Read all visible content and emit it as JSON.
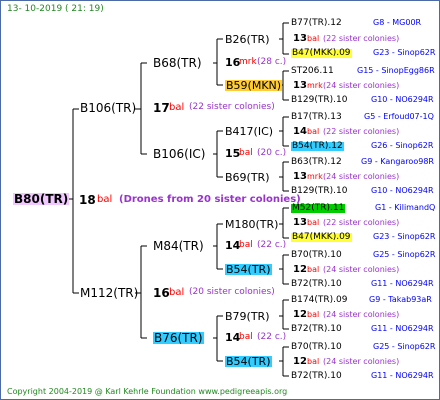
{
  "header": {
    "date_text": "13- 10-2019 ( 21: 19)"
  },
  "footer": {
    "copyright": "Copyright 2004-2019 @ Karl Kehrle Foundation   www.pedigreeapis.org"
  },
  "colors": {
    "yellow_hl": "#ffff33",
    "orange_hl": "#ffcc33",
    "cyan_hl": "#33ccff",
    "green_hl": "#00cc00",
    "pink_hl": "#f0c8ff",
    "red": "#ff0000",
    "blue": "#0000ff",
    "purple": "#9933cc"
  },
  "root": {
    "label": "B80(TR)",
    "gen": "18",
    "gen_unit": "bal",
    "note": "(Drones from 20 sister colonies)"
  },
  "gen1": [
    {
      "label": "B106(TR)",
      "gen": "17",
      "gen_unit": "bal",
      "note": "(22 sister colonies)"
    },
    {
      "label": "M112(TR)",
      "gen": "16",
      "gen_unit": "bal",
      "note": "(20 sister colonies)"
    }
  ],
  "gen2": [
    {
      "label": "B68(TR)",
      "gen": "16",
      "gen_unit": "mrk",
      "note": "(28 c.)"
    },
    {
      "label": "B106(IC)",
      "gen": "15",
      "gen_unit": "bal",
      "note": "(20 c.)"
    },
    {
      "label": "M84(TR)",
      "gen": "14",
      "gen_unit": "bal",
      "note": "(22 c.)"
    },
    {
      "label": "B76(TR)",
      "gen": "14",
      "gen_unit": "bal",
      "note": "(22 c.)"
    }
  ],
  "gen3": [
    {
      "label": "B26(TR)"
    },
    {
      "label": "B59(MKN)"
    },
    {
      "label": "B417(IC)"
    },
    {
      "label": "B69(TR)"
    },
    {
      "label": "M180(TR)"
    },
    {
      "label": "B54(TR)"
    },
    {
      "label": "B79(TR)"
    },
    {
      "label": "B54(TR)"
    }
  ],
  "gen4": [
    {
      "name": "B77(TR).12",
      "code": "G8 - MG00R"
    },
    {
      "gen": "13",
      "unit": "bal",
      "note": "(22 sister colonies)"
    },
    {
      "name": "B47(MKK).09",
      "code": "G23 - Sinop62R"
    },
    {
      "name": "ST206.11",
      "code": "G15 - SinopEgg86R"
    },
    {
      "gen": "13",
      "unit": "mrk",
      "note": "(24 sister colonies)"
    },
    {
      "name": "B129(TR).10",
      "code": "G10 - NO6294R"
    },
    {
      "name": "B17(TR).13",
      "code": "G5 - Erfoud07-1Q"
    },
    {
      "gen": "14",
      "unit": "bal",
      "note": "(22 sister colonies)"
    },
    {
      "name": "B54(TR).12",
      "code": "G26 - Sinop62R"
    },
    {
      "name": "B63(TR).12",
      "code": "G9 - Kangaroo98R"
    },
    {
      "gen": "13",
      "unit": "mrk",
      "note": "(24 sister colonies)"
    },
    {
      "name": "B129(TR).10",
      "code": "G10 - NO6294R"
    },
    {
      "name": "M52(TR).11",
      "code": "G1 - KilimandQ"
    },
    {
      "gen": "13",
      "unit": "bal",
      "note": "(22 sister colonies)"
    },
    {
      "name": "B47(MKK).09",
      "code": "G23 - Sinop62R"
    },
    {
      "name": "B70(TR).10",
      "code": "G25 - Sinop62R"
    },
    {
      "gen": "12",
      "unit": "bal",
      "note": "(24 sister colonies)"
    },
    {
      "name": "B72(TR).10",
      "code": "G11 - NO6294R"
    },
    {
      "name": "B174(TR).09",
      "code": "G9 - Takab93aR"
    },
    {
      "gen": "12",
      "unit": "bal",
      "note": "(24 sister colonies)"
    },
    {
      "name": "B72(TR).10",
      "code": "G11 - NO6294R"
    },
    {
      "name": "B70(TR).10",
      "code": "G25 - Sinop62R"
    },
    {
      "gen": "12",
      "unit": "bal",
      "note": "(24 sister colonies)"
    },
    {
      "name": "B72(TR).10",
      "code": "G11 - NO6294R"
    }
  ]
}
